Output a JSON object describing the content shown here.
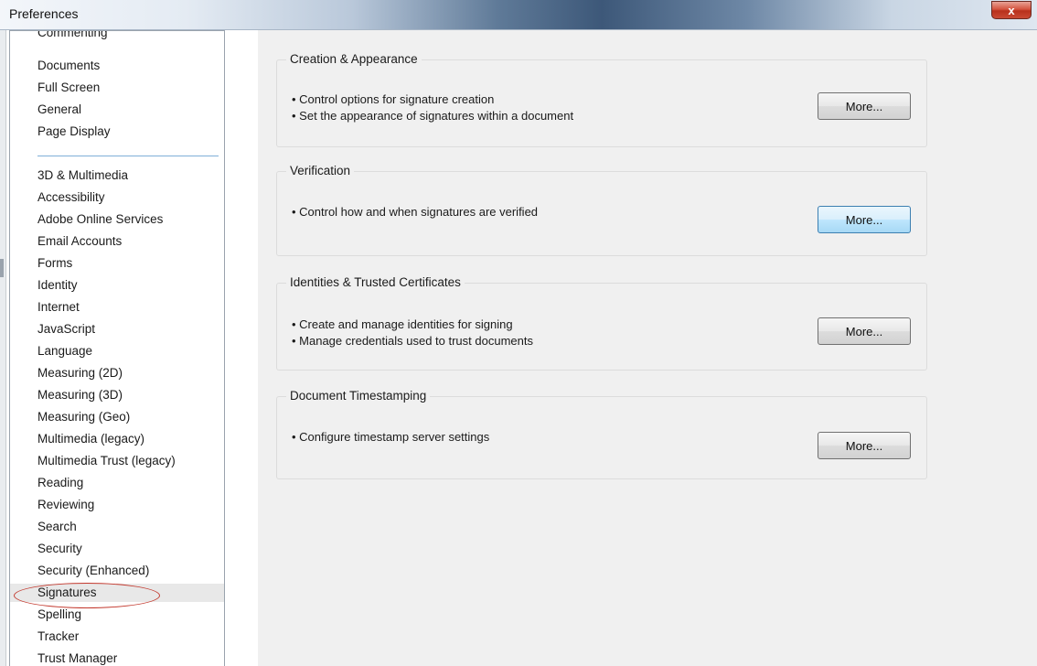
{
  "window": {
    "title": "Preferences",
    "close_label": "x"
  },
  "sidebar": {
    "cut_off_item": "Commenting",
    "items_top": [
      "Documents",
      "Full Screen",
      "General",
      "Page Display"
    ],
    "items": [
      "3D & Multimedia",
      "Accessibility",
      "Adobe Online Services",
      "Email Accounts",
      "Forms",
      "Identity",
      "Internet",
      "JavaScript",
      "Language",
      "Measuring (2D)",
      "Measuring (3D)",
      "Measuring (Geo)",
      "Multimedia (legacy)",
      "Multimedia Trust (legacy)",
      "Reading",
      "Reviewing",
      "Search",
      "Security",
      "Security (Enhanced)",
      "Signatures",
      "Spelling",
      "Tracker",
      "Trust Manager"
    ],
    "selected": "Signatures"
  },
  "groups": [
    {
      "title": "Creation & Appearance",
      "bullets": [
        "• Control options for signature creation",
        "• Set the appearance of signatures within a document"
      ],
      "button": "More..."
    },
    {
      "title": "Verification",
      "bullets": [
        "• Control how and when signatures are verified"
      ],
      "button": "More..."
    },
    {
      "title": "Identities & Trusted Certificates",
      "bullets": [
        "• Create and manage identities for signing",
        "• Manage credentials used to trust documents"
      ],
      "button": "More..."
    },
    {
      "title": "Document Timestamping",
      "bullets": [
        "• Configure timestamp server settings"
      ],
      "button": "More..."
    }
  ]
}
